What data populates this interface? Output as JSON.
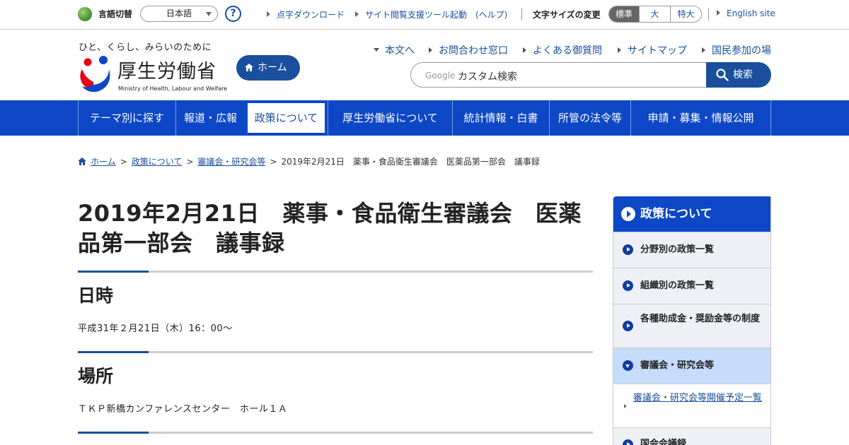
{
  "topbar": {
    "lang_label": "言語切替",
    "lang_value": "日本語",
    "help_glyph": "?",
    "links": [
      "点字ダウンロード",
      "サイト閲覧支援ツール起動　(ヘルプ)"
    ],
    "fontsize_label": "文字サイズの変更",
    "fontsize_options": [
      "標準",
      "大",
      "特大"
    ],
    "english_link": "English site"
  },
  "header": {
    "tagline": "ひと、くらし、みらいのために",
    "logo_jp": "厚生労働省",
    "logo_en": "Ministry of Health, Labour and Welfare",
    "home_label": "ホーム",
    "links": [
      "本文へ",
      "お問合わせ窓口",
      "よくある御質問",
      "サイトマップ",
      "国民参加の場"
    ],
    "search_brand": "Google",
    "search_placeholder": "カスタム検索",
    "search_button": "検索"
  },
  "gnav": [
    "テーマ別に探す",
    "報道・広報",
    "政策について",
    "厚生労働省について",
    "統計情報・白書",
    "所管の法令等",
    "申請・募集・情報公開"
  ],
  "breadcrumb": {
    "items": [
      "ホーム",
      "政策について",
      "審議会・研究会等"
    ],
    "current": "2019年2月21日　薬事・食品衛生審議会　医薬品第一部会　議事録",
    "sep": ">"
  },
  "main": {
    "title": "2019年2月21日　薬事・食品衛生審議会　医薬品第一部会　議事録",
    "sections": [
      {
        "heading": "日時",
        "text": "平成31年２月21日（木）16：00～"
      },
      {
        "heading": "場所",
        "text": "ＴＫＰ新橋カンファレンスセンター　ホール１Ａ"
      }
    ]
  },
  "sidebar": {
    "title": "政策について",
    "items": [
      "分野別の政策一覧",
      "組織別の政策一覧",
      "各種助成金・奨励金等の制度",
      "審議会・研究会等"
    ],
    "sub_items": [
      "審議会・研究会等開催予定一覧"
    ],
    "next_item": "国会会議録"
  },
  "colors": {
    "primary": "#0d47c6",
    "link": "#1a4f9e",
    "side_active": "#c5dcfa"
  }
}
